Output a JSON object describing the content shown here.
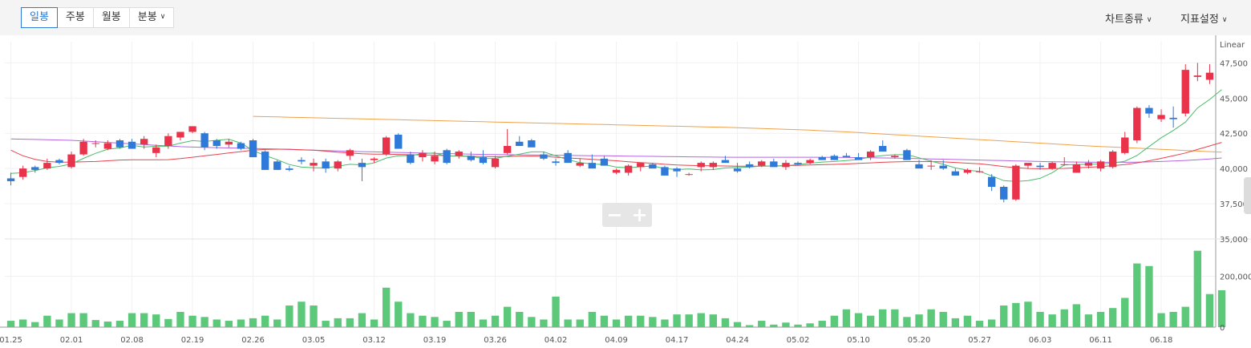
{
  "toolbar": {
    "periods": [
      {
        "label": "일봉",
        "active": true
      },
      {
        "label": "주봉",
        "active": false
      },
      {
        "label": "월봉",
        "active": false
      },
      {
        "label": "분봉",
        "active": false
      }
    ],
    "chart_type_label": "차트종류",
    "indicator_label": "지표설정"
  },
  "chart_data": {
    "type": "candlestick",
    "scale_label": "Linear",
    "price_axis": {
      "ticks": [
        "47,500",
        "45,000",
        "42,500",
        "40,000",
        "37,500",
        "35,000"
      ],
      "ylim": [
        35000,
        49000
      ]
    },
    "volume_axis": {
      "ticks": [
        "200,000",
        "0"
      ],
      "ylim": [
        0,
        340000
      ]
    },
    "x_ticks": [
      "01.25",
      "02.01",
      "02.08",
      "02.19",
      "02.26",
      "03.05",
      "03.12",
      "03.19",
      "03.26",
      "04.02",
      "04.09",
      "04.17",
      "04.24",
      "05.02",
      "05.10",
      "05.20",
      "05.27",
      "06.03",
      "06.11",
      "06.18"
    ],
    "x_tick_index": [
      0,
      5,
      10,
      15,
      20,
      25,
      30,
      35,
      40,
      45,
      50,
      55,
      60,
      65,
      70,
      75,
      80,
      85,
      90,
      95
    ],
    "colors": {
      "up": "#e8334a",
      "down": "#2f7ad8",
      "volume": "#5cc97a",
      "ma5": "#4cbb6c",
      "ma20": "#e8434e",
      "ma60": "#b565e0",
      "ma120": "#f0a04a"
    },
    "candles": [
      [
        39300,
        39700,
        38800,
        39100
      ],
      [
        39400,
        40200,
        39200,
        40000
      ],
      [
        40100,
        40200,
        39700,
        39900
      ],
      [
        40000,
        40700,
        39900,
        40400
      ],
      [
        40600,
        40700,
        40300,
        40400
      ],
      [
        40100,
        41200,
        40000,
        41000
      ],
      [
        41000,
        42100,
        40900,
        41900
      ],
      [
        41800,
        42000,
        41500,
        41800
      ],
      [
        41400,
        42000,
        41300,
        41800
      ],
      [
        42000,
        42100,
        41400,
        41500
      ],
      [
        41900,
        42100,
        41400,
        41400
      ],
      [
        41700,
        42300,
        41400,
        42100
      ],
      [
        41100,
        41700,
        40800,
        41500
      ],
      [
        41600,
        42500,
        41400,
        42300
      ],
      [
        42200,
        42500,
        42000,
        42600
      ],
      [
        42600,
        43000,
        42500,
        43000
      ],
      [
        42500,
        42600,
        41300,
        41500
      ],
      [
        42000,
        42100,
        41400,
        41600
      ],
      [
        41700,
        42100,
        41500,
        41900
      ],
      [
        41800,
        41900,
        41300,
        41400
      ],
      [
        42000,
        42100,
        41000,
        40800
      ],
      [
        41200,
        41300,
        39900,
        39900
      ],
      [
        40500,
        40600,
        39900,
        39900
      ],
      [
        40000,
        40200,
        39800,
        39900
      ],
      [
        40600,
        40800,
        40300,
        40500
      ],
      [
        40200,
        40700,
        39800,
        40400
      ],
      [
        40500,
        40700,
        39700,
        40000
      ],
      [
        40000,
        40600,
        39800,
        40500
      ],
      [
        40900,
        41400,
        40600,
        41300
      ],
      [
        40400,
        40700,
        39100,
        40100
      ],
      [
        40600,
        40800,
        40400,
        40700
      ],
      [
        41000,
        42300,
        40900,
        42200
      ],
      [
        42400,
        42500,
        41400,
        41400
      ],
      [
        41000,
        41200,
        40300,
        40400
      ],
      [
        40800,
        41300,
        40500,
        41100
      ],
      [
        40500,
        41200,
        40300,
        40900
      ],
      [
        41300,
        41400,
        40300,
        40400
      ],
      [
        40900,
        41300,
        40700,
        41200
      ],
      [
        40900,
        41200,
        40500,
        40600
      ],
      [
        40800,
        41300,
        40300,
        40400
      ],
      [
        40100,
        40900,
        40000,
        40700
      ],
      [
        41100,
        42800,
        41000,
        41600
      ],
      [
        41900,
        42300,
        41800,
        41600
      ],
      [
        42000,
        42100,
        41600,
        41500
      ],
      [
        41000,
        41200,
        40600,
        40700
      ],
      [
        40500,
        40700,
        40200,
        40400
      ],
      [
        41100,
        41300,
        40400,
        40400
      ],
      [
        40200,
        40700,
        40100,
        40400
      ],
      [
        40400,
        41000,
        40000,
        40000
      ],
      [
        40700,
        40900,
        40200,
        40200
      ],
      [
        39700,
        40000,
        39600,
        39900
      ],
      [
        39700,
        40300,
        39500,
        40200
      ],
      [
        40100,
        40400,
        39800,
        40400
      ],
      [
        40300,
        40400,
        40100,
        40000
      ],
      [
        40100,
        40200,
        39700,
        39500
      ],
      [
        40000,
        40100,
        39400,
        39800
      ],
      [
        39600,
        39700,
        39500,
        39600
      ],
      [
        40100,
        40500,
        39800,
        40400
      ],
      [
        40100,
        40500,
        39900,
        40400
      ],
      [
        40600,
        40900,
        40400,
        40400
      ],
      [
        40000,
        40400,
        39700,
        39800
      ],
      [
        40300,
        40500,
        40000,
        40100
      ],
      [
        40200,
        40600,
        40100,
        40500
      ],
      [
        40500,
        40700,
        40200,
        40100
      ],
      [
        40100,
        40600,
        39900,
        40400
      ],
      [
        40400,
        40500,
        40200,
        40300
      ],
      [
        40400,
        40700,
        40300,
        40600
      ],
      [
        40800,
        40900,
        40600,
        40600
      ],
      [
        40900,
        41000,
        40600,
        40600
      ],
      [
        40900,
        41100,
        40800,
        40800
      ],
      [
        40800,
        41100,
        40700,
        40600
      ],
      [
        40800,
        41300,
        40600,
        41200
      ],
      [
        41600,
        42000,
        41200,
        41200
      ],
      [
        40800,
        41000,
        40700,
        40900
      ],
      [
        41300,
        41400,
        40600,
        40600
      ],
      [
        40300,
        40600,
        40100,
        40000
      ],
      [
        40200,
        40600,
        39900,
        40200
      ],
      [
        40200,
        40600,
        39900,
        40000
      ],
      [
        39800,
        40000,
        39500,
        39500
      ],
      [
        39700,
        40000,
        39600,
        39900
      ],
      [
        39800,
        40100,
        39700,
        39800
      ],
      [
        39400,
        39600,
        38400,
        38700
      ],
      [
        38700,
        38800,
        37600,
        37800
      ],
      [
        37800,
        40300,
        37700,
        40200
      ],
      [
        40200,
        40300,
        40000,
        40400
      ],
      [
        40200,
        40400,
        39900,
        40100
      ],
      [
        40000,
        40500,
        39900,
        40400
      ],
      [
        40300,
        40800,
        40200,
        40300
      ],
      [
        39700,
        40500,
        39700,
        40300
      ],
      [
        40200,
        40600,
        40000,
        40400
      ],
      [
        40000,
        40600,
        39800,
        40500
      ],
      [
        40100,
        41300,
        40000,
        41200
      ],
      [
        41100,
        42600,
        41000,
        42200
      ],
      [
        42000,
        44400,
        41800,
        44300
      ],
      [
        44300,
        44500,
        43600,
        43900
      ],
      [
        43500,
        44200,
        43300,
        43800
      ],
      [
        43600,
        44400,
        42900,
        43500
      ],
      [
        43900,
        47400,
        43700,
        47000
      ],
      [
        46500,
        47500,
        46200,
        46600
      ],
      [
        46300,
        47400,
        46000,
        46800
      ]
    ],
    "volume": [
      25000,
      30000,
      20000,
      45000,
      30000,
      55000,
      55000,
      28000,
      22000,
      25000,
      55000,
      55000,
      50000,
      32000,
      60000,
      45000,
      40000,
      30000,
      25000,
      30000,
      35000,
      45000,
      30000,
      85000,
      100000,
      85000,
      25000,
      35000,
      35000,
      55000,
      30000,
      155000,
      100000,
      55000,
      45000,
      40000,
      25000,
      60000,
      60000,
      30000,
      45000,
      80000,
      60000,
      40000,
      30000,
      120000,
      30000,
      30000,
      60000,
      45000,
      30000,
      45000,
      45000,
      40000,
      30000,
      50000,
      50000,
      55000,
      50000,
      35000,
      20000,
      8000,
      25000,
      10000,
      18000,
      10000,
      15000,
      25000,
      45000,
      70000,
      55000,
      45000,
      70000,
      70000,
      40000,
      50000,
      70000,
      60000,
      35000,
      45000,
      25000,
      30000,
      85000,
      95000,
      100000,
      60000,
      50000,
      70000,
      90000,
      50000,
      60000,
      75000,
      115000,
      250000,
      240000,
      55000,
      60000,
      80000,
      300000,
      130000,
      145000
    ],
    "ma5": [
      39650,
      39700,
      39850,
      40050,
      40150,
      40320,
      40720,
      41080,
      41370,
      41460,
      41640,
      41520,
      41580,
      41580,
      41800,
      41980,
      41920,
      42000,
      42080,
      41800,
      41280,
      40920,
      40620,
      40280,
      40100,
      40060,
      40040,
      40160,
      40300,
      40260,
      40400,
      40740,
      40900,
      40920,
      41060,
      41100,
      40870,
      40900,
      40860,
      40700,
      40720,
      40880,
      41020,
      41180,
      41180,
      40900,
      40630,
      40420,
      40320,
      40280,
      40100,
      40060,
      40120,
      40180,
      40000,
      39920,
      39960,
      39900,
      39920,
      40040,
      40080,
      40100,
      40180,
      40180,
      40200,
      40280,
      40380,
      40460,
      40500,
      40560,
      40640,
      40820,
      40920,
      40980,
      40980,
      40760,
      40520,
      40300,
      40040,
      39880,
      39800,
      39480,
      39140,
      39080,
      39140,
      39300,
      39700,
      40260,
      40280,
      40300,
      40320,
      40380,
      40520,
      40920,
      41560,
      42180,
      42700,
      43300,
      44300,
      44900,
      45600
    ],
    "ma20": [
      41300,
      40900,
      40650,
      40500,
      40450,
      40450,
      40480,
      40500,
      40550,
      40600,
      40620,
      40620,
      40620,
      40630,
      40700,
      40800,
      40900,
      41000,
      41100,
      41200,
      41300,
      41350,
      41370,
      41370,
      41330,
      41300,
      41230,
      41150,
      41100,
      41050,
      41020,
      41020,
      41000,
      40980,
      40960,
      40950,
      40900,
      40880,
      40860,
      40850,
      40840,
      40850,
      40870,
      40880,
      40870,
      40800,
      40750,
      40700,
      40650,
      40600,
      40550,
      40480,
      40420,
      40370,
      40300,
      40250,
      40220,
      40200,
      40190,
      40180,
      40170,
      40160,
      40170,
      40180,
      40200,
      40220,
      40250,
      40270,
      40290,
      40320,
      40360,
      40400,
      40440,
      40470,
      40490,
      40500,
      40490,
      40470,
      40430,
      40380,
      40330,
      40240,
      40140,
      40060,
      40000,
      39980,
      39990,
      40010,
      40050,
      40090,
      40140,
      40200,
      40280,
      40400,
      40550,
      40720,
      40900,
      41100,
      41350,
      41600,
      41850
    ],
    "ma60": [
      42100,
      42080,
      42060,
      42040,
      42020,
      42000,
      41950,
      41900,
      41850,
      41800,
      41750,
      41700,
      41650,
      41600,
      41550,
      41520,
      41500,
      41480,
      41460,
      41440,
      41420,
      41400,
      41380,
      41350,
      41320,
      41300,
      41280,
      41250,
      41220,
      41200,
      41180,
      41160,
      41140,
      41120,
      41100,
      41080,
      41060,
      41040,
      41020,
      41000,
      40990,
      40980,
      40970,
      40960,
      40950,
      40940,
      40930,
      40920,
      40910,
      40900,
      40890,
      40880,
      40870,
      40860,
      40850,
      40840,
      40830,
      40820,
      40810,
      40800,
      40800,
      40800,
      40800,
      40800,
      40800,
      40800,
      40800,
      40800,
      40790,
      40780,
      40770,
      40760,
      40750,
      40740,
      40720,
      40700,
      40680,
      40660,
      40640,
      40620,
      40600,
      40580,
      40560,
      40540,
      40520,
      40500,
      40480,
      40470,
      40460,
      40450,
      40440,
      40440,
      40440,
      40450,
      40470,
      40500,
      40530,
      40570,
      40620,
      40680,
      40750
    ],
    "ma120": [
      null,
      null,
      null,
      null,
      null,
      null,
      null,
      null,
      null,
      null,
      null,
      null,
      null,
      null,
      null,
      null,
      null,
      null,
      null,
      null,
      43700,
      43680,
      43660,
      43640,
      43620,
      43600,
      43580,
      43560,
      43540,
      43520,
      43500,
      43480,
      43460,
      43440,
      43420,
      43400,
      43380,
      43360,
      43340,
      43320,
      43300,
      43280,
      43260,
      43240,
      43220,
      43200,
      43180,
      43160,
      43140,
      43120,
      43100,
      43080,
      43060,
      43040,
      43020,
      43000,
      42980,
      42960,
      42940,
      42920,
      42900,
      42870,
      42840,
      42810,
      42780,
      42750,
      42720,
      42680,
      42640,
      42600,
      42550,
      42500,
      42450,
      42400,
      42350,
      42300,
      42250,
      42200,
      42150,
      42100,
      42050,
      42000,
      41950,
      41900,
      41850,
      41800,
      41750,
      41700,
      41650,
      41600,
      41560,
      41520,
      41480,
      41440,
      41400,
      41360,
      41320,
      41280,
      41240,
      41200,
      41160
    ]
  }
}
